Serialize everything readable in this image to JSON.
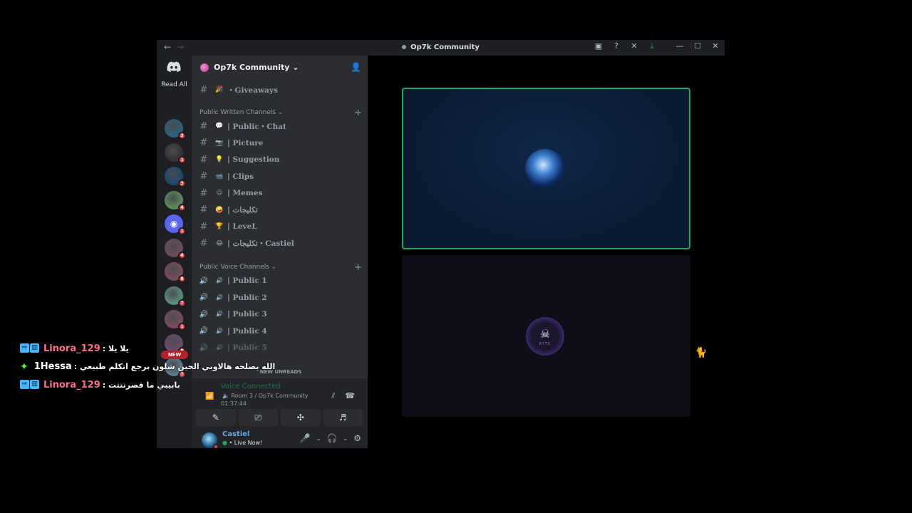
{
  "window": {
    "title": "Op7k Community",
    "back": "←",
    "forward": "→",
    "icons": [
      "inbox-icon",
      "help-icon",
      "tools-icon",
      "download-icon",
      "minimize-icon",
      "maximize-icon",
      "close-icon"
    ]
  },
  "guild_bar": {
    "read_all": "Read All",
    "guilds": [
      {
        "badge": "3",
        "color": "#2a5f7a"
      },
      {
        "badge": "1",
        "color": "#333333"
      },
      {
        "badge": "3",
        "color": "#1d4a6a"
      },
      {
        "badge": "4",
        "color": "#5a8a5a"
      },
      {
        "badge": "1",
        "color": "#5865f2"
      },
      {
        "badge": "4",
        "color": "#6a4a5a"
      },
      {
        "badge": "8",
        "color": "#7a4a5a"
      },
      {
        "badge": "7",
        "color": "#5a8a7a"
      },
      {
        "badge": "1",
        "color": "#7a4a5a"
      },
      {
        "badge": "9",
        "color": "#6a4a6a"
      },
      {
        "badge": "7",
        "color": "#5a7a8a"
      }
    ]
  },
  "server": {
    "name": "Op7k Community",
    "chevron": "⌄"
  },
  "channels": {
    "top": {
      "emoji": "🎉",
      "name": "・Giveaways"
    },
    "cat_written": "Public Written Channels ⌄",
    "written": [
      {
        "emoji": "💬",
        "name": "| Public・Chat"
      },
      {
        "emoji": "📷",
        "name": "| Picture"
      },
      {
        "emoji": "💡",
        "name": "| Suggestion"
      },
      {
        "emoji": "📹",
        "name": "| Clips"
      },
      {
        "emoji": "😉",
        "name": "| Memes"
      },
      {
        "emoji": "🤪",
        "name": "| تكليجات"
      },
      {
        "emoji": "🏆",
        "name": "| LeveL"
      },
      {
        "emoji": "😂",
        "name": "| تكليجات・Castiel"
      }
    ],
    "cat_voice": "Public Voice Channels ⌄",
    "voice": [
      {
        "name": "| Public 1"
      },
      {
        "name": "| Public 2"
      },
      {
        "name": "| Public 3"
      },
      {
        "name": "| Public 4"
      },
      {
        "name": "| Public 5"
      }
    ],
    "new_unreads": "NEW UNREADS"
  },
  "voice_status": {
    "title": "Voice Connected",
    "channel": "Room 3 / Op7k Community",
    "time": "01:37:44"
  },
  "user": {
    "name": "Castiel",
    "status": "• Live Now!"
  },
  "chat_overlay": {
    "new_label": "NEW",
    "messages": [
      {
        "name": "Linora_129",
        "name_color": "#ff6b8a",
        "text": "يلا يلا :",
        "platform": "kick-twitch"
      },
      {
        "name": "1Hessa",
        "name_color": "#ffffff",
        "text": "الله يصلحه هالاوبي الحين شلون برجع اتكلم طبيعي :",
        "platform": "kick-diamond"
      },
      {
        "name": "Linora_129",
        "name_color": "#ff6b8a",
        "text": "بابيبي ما قصرتتتت :",
        "platform": "kick-twitch"
      }
    ]
  },
  "video_tiles": {
    "tile2_label": "BYTE"
  }
}
